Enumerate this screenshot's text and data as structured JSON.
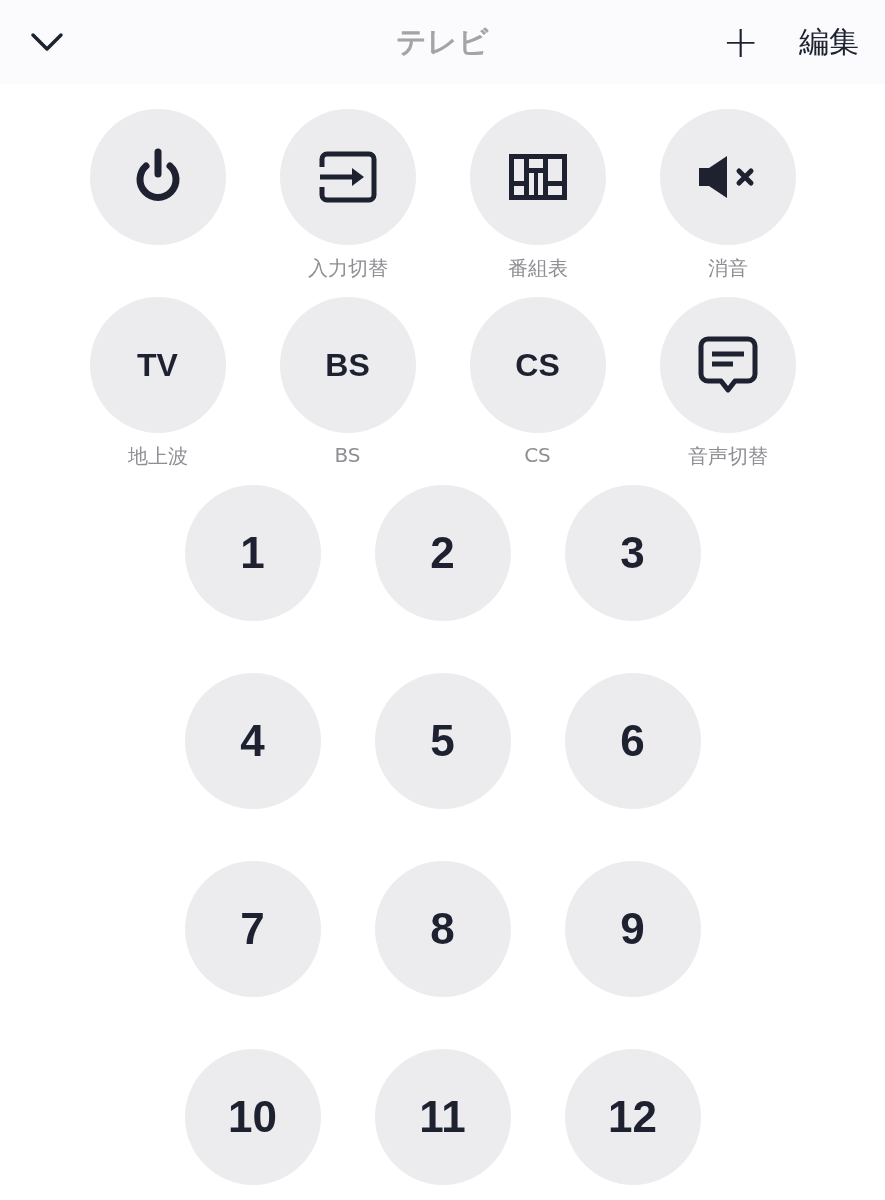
{
  "header": {
    "title": "テレビ",
    "add_label": "+",
    "edit_label": "編集"
  },
  "buttons": [
    {
      "kind": "power"
    },
    {
      "kind": "input",
      "label": "入力切替"
    },
    {
      "kind": "guide",
      "label": "番組表"
    },
    {
      "kind": "mute",
      "label": "消音"
    },
    {
      "kind": "text",
      "text": "TV",
      "label": "地上波"
    },
    {
      "kind": "text",
      "text": "BS",
      "label": "BS"
    },
    {
      "kind": "text",
      "text": "CS",
      "label": "CS"
    },
    {
      "kind": "audio",
      "label": "音声切替"
    }
  ],
  "numbers": [
    "1",
    "2",
    "3",
    "4",
    "5",
    "6",
    "7",
    "8",
    "9",
    "10",
    "11",
    "12"
  ]
}
